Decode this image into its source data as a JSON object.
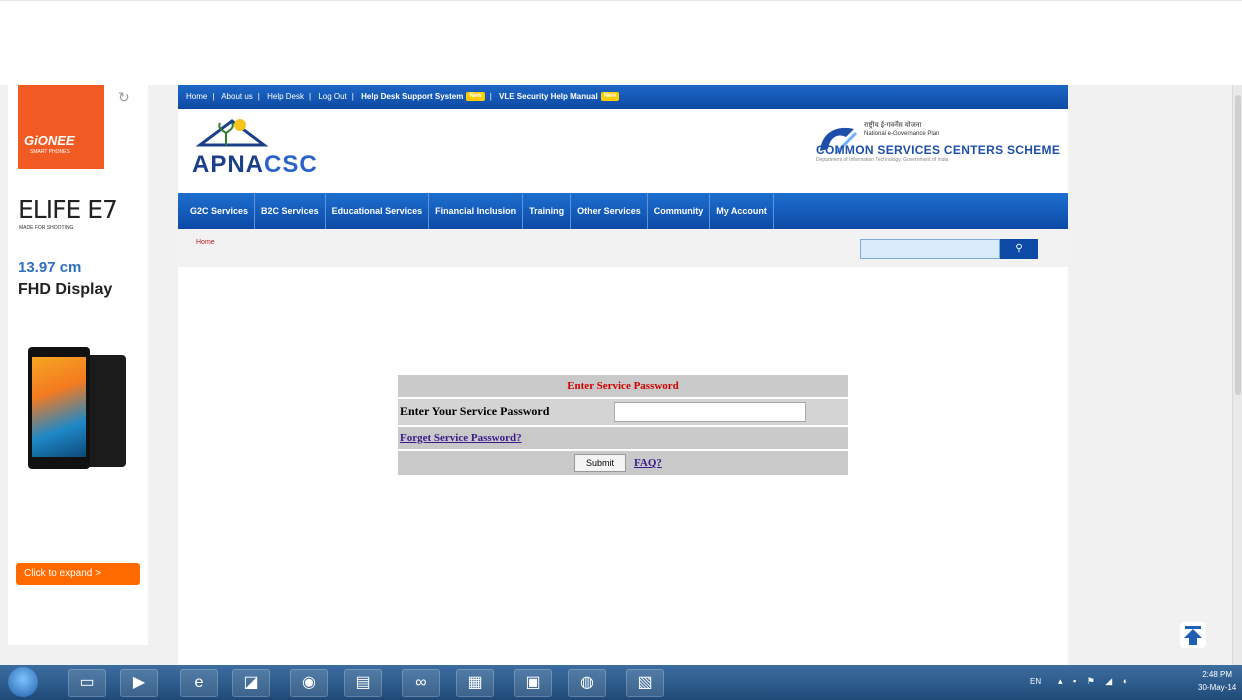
{
  "ad": {
    "brand": "GiONEE",
    "brand_tagline": "SMART PHONES",
    "model": "ELIFE E7",
    "model_tagline": "MADE FOR SHOOTING",
    "size": "13.97 cm",
    "display": "FHD Display",
    "expand": "Click to expand >"
  },
  "portal": {
    "topnav": {
      "items": [
        "Home",
        "About us",
        "Help Desk",
        "Log Out"
      ],
      "hdss": "Help Desk Support System",
      "vle": "VLE Security Help Manual",
      "new_badge": "New"
    },
    "logo": {
      "apna": "APNA",
      "csc": "CSC"
    },
    "egov": {
      "hindi": "राष्ट्रीय ई-गवर्नेंस योजना",
      "nep": "National e-Governance Plan",
      "title": "COMMON SERVICES CENTERS SCHEME",
      "dept": "Department of Information Technology, Government of India"
    },
    "mainnav": [
      "G2C Services",
      "B2C Services",
      "Educational Services",
      "Financial Inclusion",
      "Training",
      "Other Services",
      "Community",
      "My Account"
    ],
    "breadcrumb": "Home",
    "password_form": {
      "title": "Enter Service Password",
      "label": "Enter Your Service Password",
      "value": "",
      "forget_link": "Forget Service Password?",
      "submit": "Submit",
      "faq": "FAQ?"
    }
  },
  "taskbar": {
    "lang": "EN",
    "time": "2:48 PM",
    "date": "30-May-14"
  },
  "colors": {
    "nav_blue": "#0e4aa3",
    "title_red": "#d00000",
    "ad_orange": "#f15a22"
  }
}
